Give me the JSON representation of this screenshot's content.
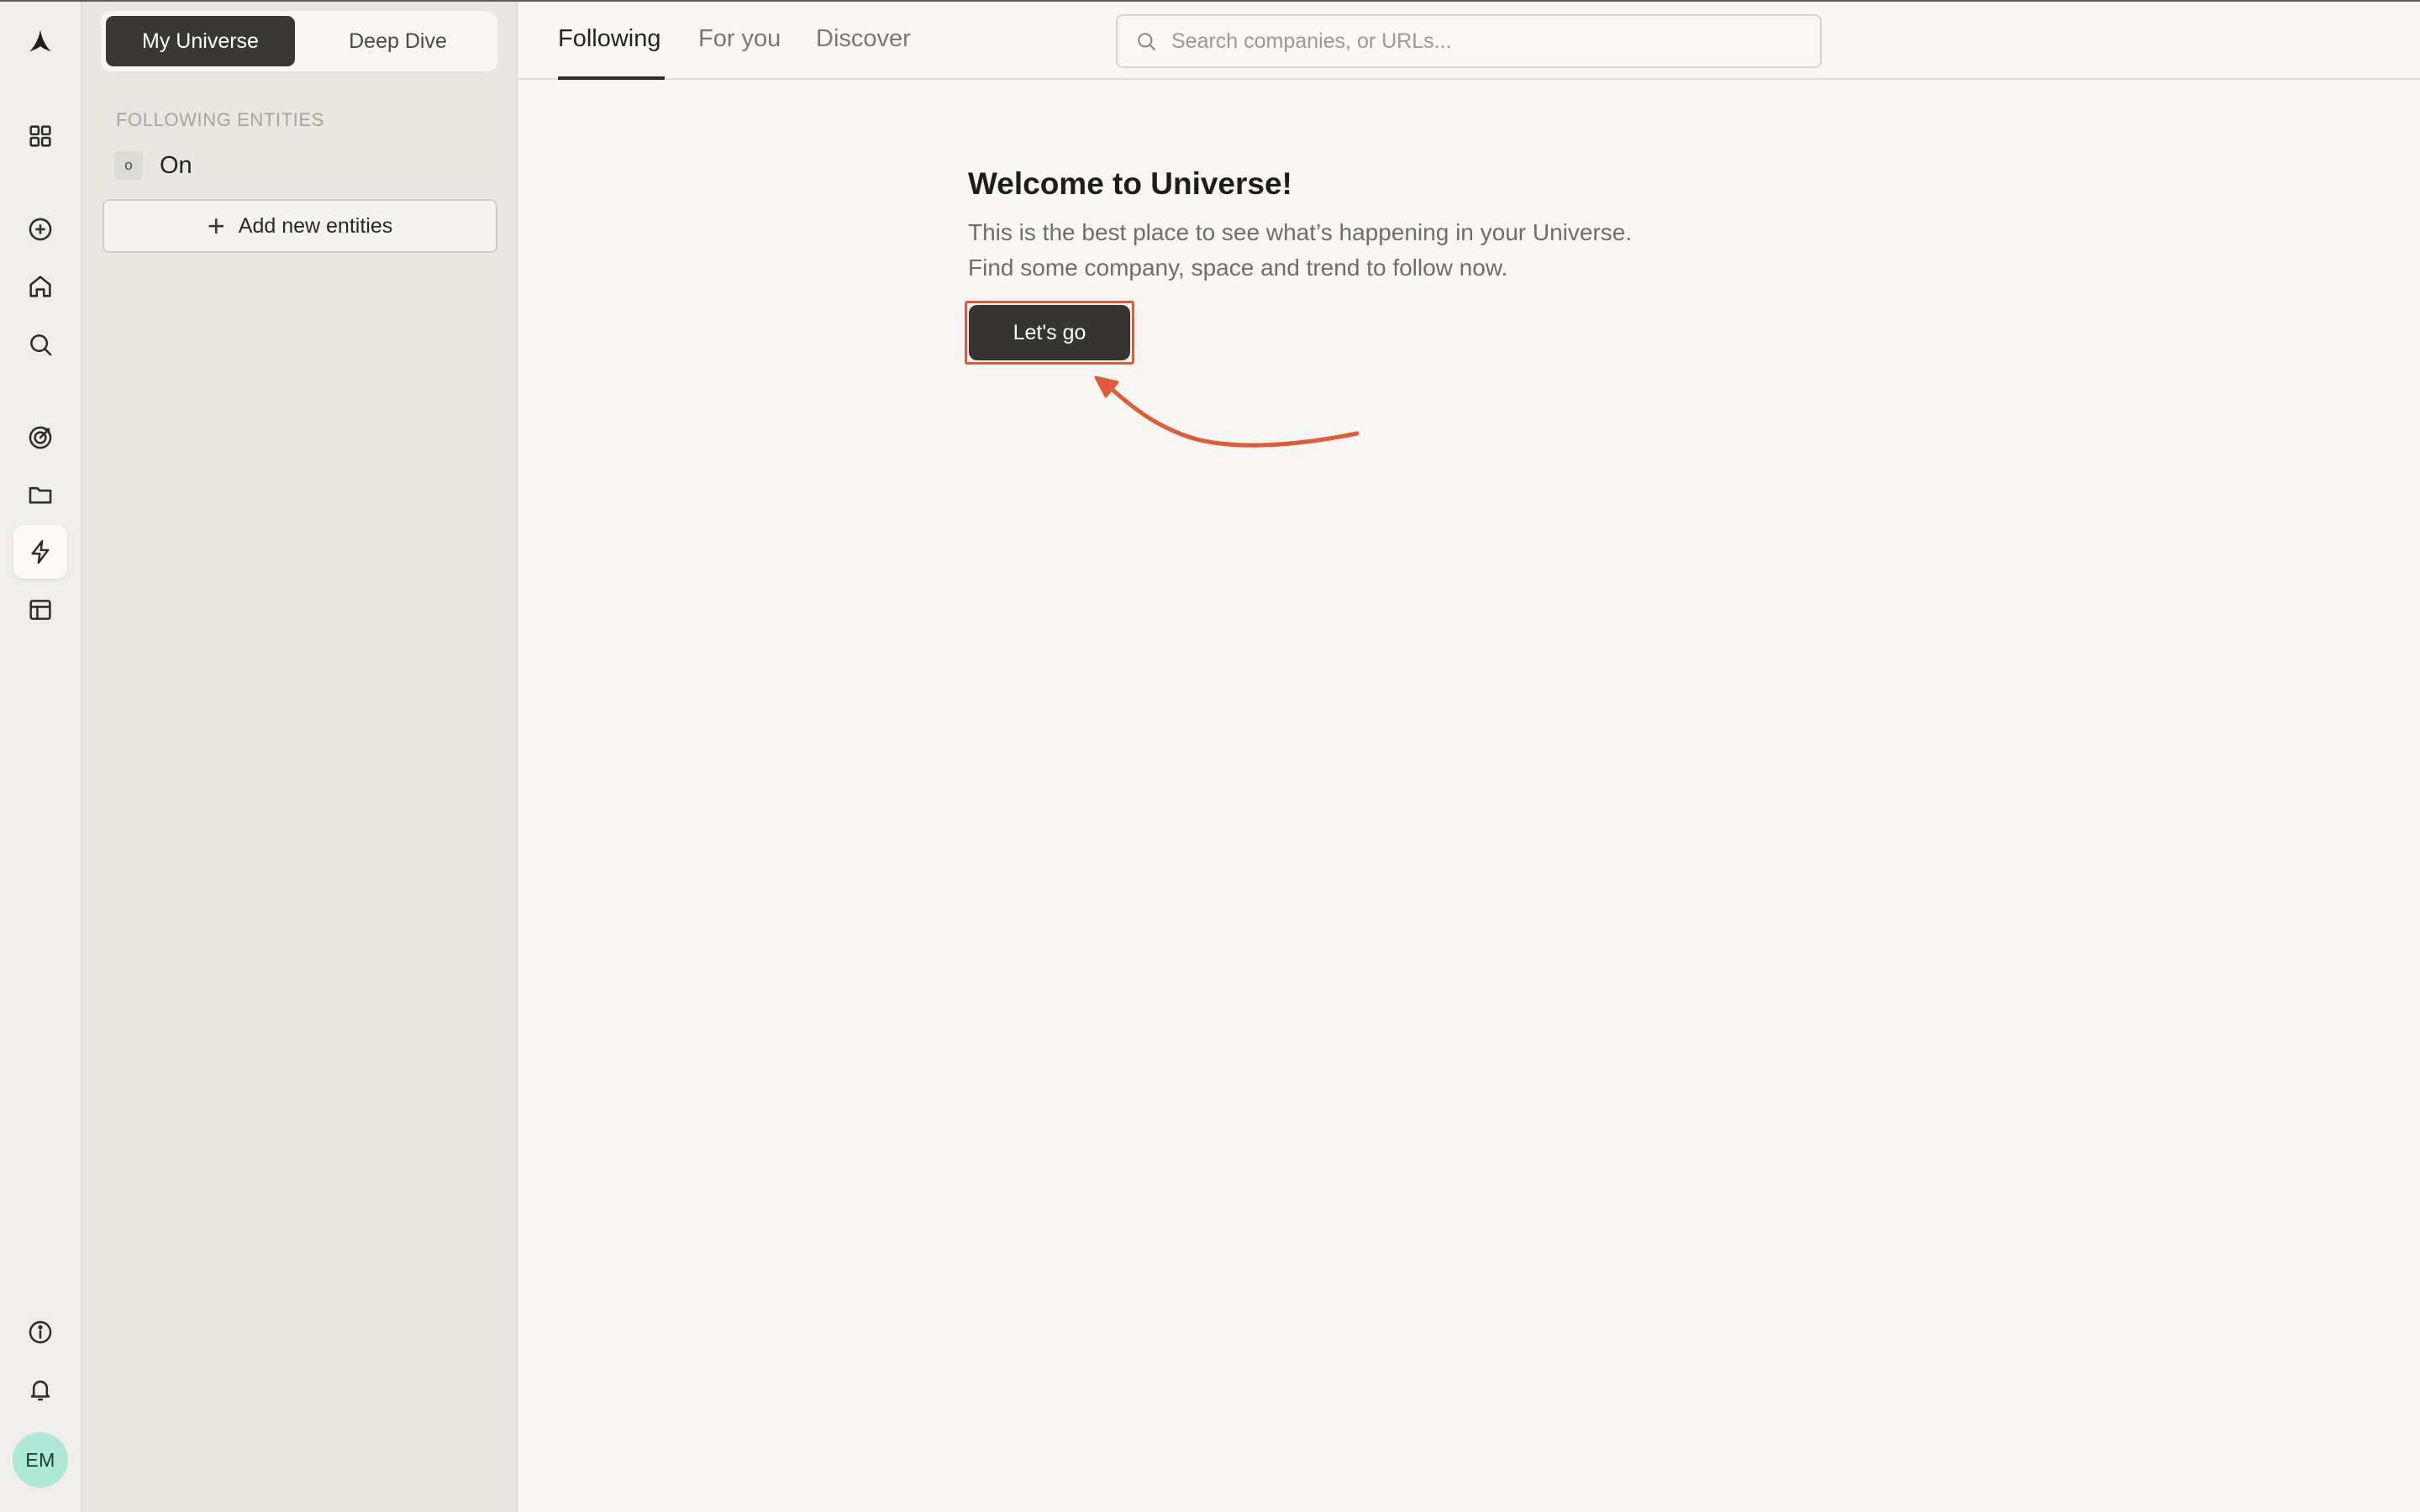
{
  "rail": {
    "logo": "brand-logo",
    "icons": [
      "grid-icon",
      "plus-circle-icon",
      "home-icon",
      "search-icon",
      "target-icon",
      "folder-icon",
      "bolt-icon",
      "layout-icon",
      "info-icon",
      "bell-icon"
    ],
    "active": "bolt-icon",
    "avatar_initials": "EM"
  },
  "sidebar": {
    "toggle": {
      "options": [
        "My Universe",
        "Deep Dive"
      ],
      "selected": "My Universe"
    },
    "section_label": "FOLLOWING ENTITIES",
    "entities": [
      {
        "badge": "o",
        "label": "On"
      }
    ],
    "add_button": "Add new entities"
  },
  "topbar": {
    "tabs": [
      "Following",
      "For you",
      "Discover"
    ],
    "active_tab": "Following",
    "search_placeholder": "Search companies, or URLs..."
  },
  "welcome": {
    "title": "Welcome to Universe!",
    "line1": "This is the best place to see what’s happening in your Universe.",
    "line2": "Find some company, space and trend to follow now.",
    "cta": "Let's go"
  },
  "colors": {
    "accent": "#e15a3a",
    "dark_button": "#363431",
    "avatar": "#aee8d6",
    "background": "#f8f7f3"
  }
}
